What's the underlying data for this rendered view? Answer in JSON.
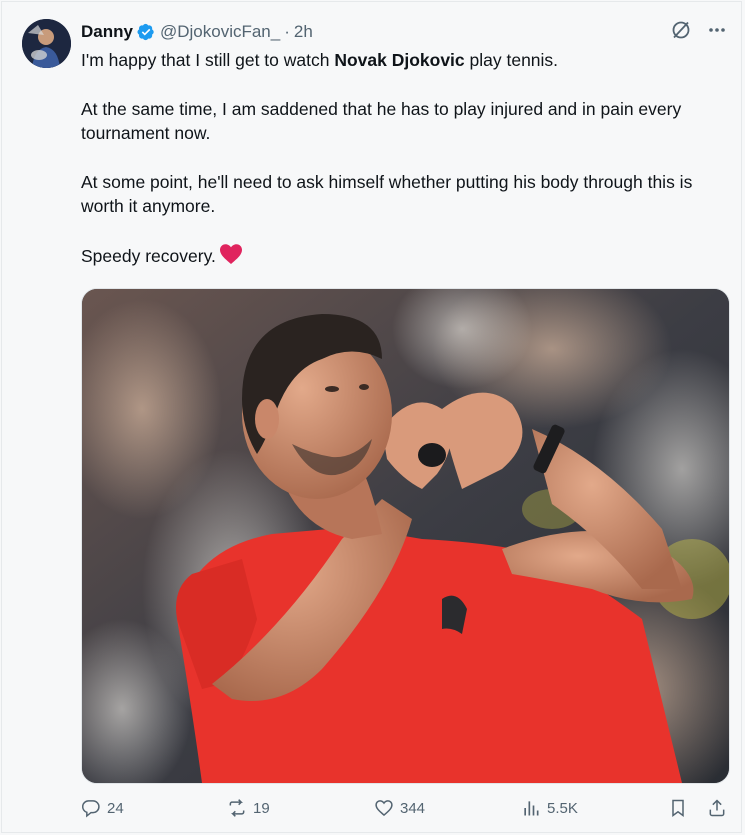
{
  "tweet": {
    "author_name": "Danny",
    "handle": "@DjokovicFan_",
    "separator": "·",
    "time": "2h",
    "text_intro": "I'm happy that I still get to watch ",
    "text_bold": "Novak Djokovic",
    "text_intro_end": " play tennis.",
    "paragraph2": "At the same time, I am saddened that he has to play injured and in pain every tournament now.",
    "paragraph3": "At some point, he'll need to ask himself whether putting his body through this is worth it anymore.",
    "paragraph4": "Speedy recovery.",
    "image_description": "player-making-heart-gesture"
  },
  "actions": {
    "replies": "24",
    "reposts": "19",
    "likes": "344",
    "views": "5.5K"
  },
  "colors": {
    "accent": "#1d9bf0",
    "heart": "#e0245e",
    "shirt": "#e8332c"
  }
}
